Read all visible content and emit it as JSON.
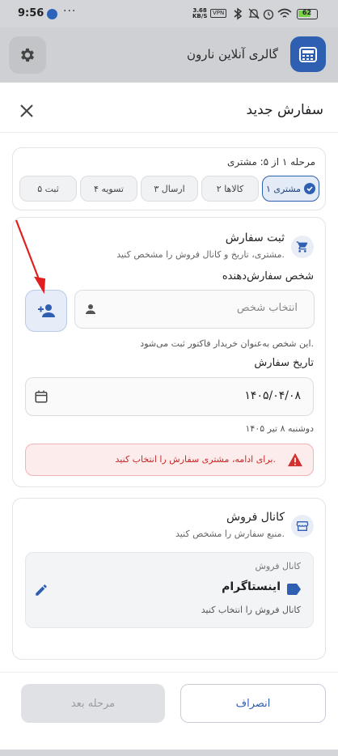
{
  "status_bar": {
    "time": "9:56",
    "dots": "···",
    "speed_value": "3.68",
    "speed_unit": "KB/S",
    "vpn": "VPN",
    "battery": "62"
  },
  "app_header": {
    "title": "گالری آنلاین نارون",
    "settings_icon": "gear-icon",
    "brand_icon": "register-icon"
  },
  "sheet": {
    "title": "سفارش جدید",
    "close_icon": "close-icon"
  },
  "stepper": {
    "label": "مرحله ۱ از ۵: مشتری",
    "steps": [
      {
        "label": "۱ مشتری",
        "active": true
      },
      {
        "label": "۲ کالاها",
        "active": false
      },
      {
        "label": "۳ ارسال",
        "active": false
      },
      {
        "label": "۴ تسویه",
        "active": false
      },
      {
        "label": "۵ ثبت",
        "active": false
      }
    ],
    "active_color": "#2f5fb0"
  },
  "order_section": {
    "title": "ثبت سفارش",
    "subtitle": "مشتری، تاریخ و کانال فروش را مشخص کنید.",
    "icon": "cart-icon",
    "person_label": "شخص سفارش‌دهنده",
    "person_placeholder": "انتخاب شخص",
    "person_helper": "این شخص به‌عنوان خریدار فاکتور ثبت می‌شود.",
    "add_person_icon": "add-person-icon",
    "date_label": "تاریخ سفارش",
    "date_value": "۱۴۰۵/۰۴/۰۸",
    "date_helper": "دوشنبه ۸ تیر ۱۴۰۵",
    "calendar_icon": "calendar-icon",
    "alert_text": "برای ادامه، مشتری سفارش را انتخاب کنید.",
    "alert_icon": "warning-icon",
    "alert_color": "#c62828"
  },
  "channel_section": {
    "title": "کانال فروش",
    "subtitle": "منبع سفارش را مشخص کنید.",
    "icon": "store-icon",
    "field_label": "کانال فروش",
    "value": "اینستاگرام",
    "hint": "کانال فروش را انتخاب کنید",
    "tag_icon": "tag-icon",
    "edit_icon": "edit-icon"
  },
  "footer": {
    "cancel_label": "انصراف",
    "next_label": "مرحله بعد"
  }
}
